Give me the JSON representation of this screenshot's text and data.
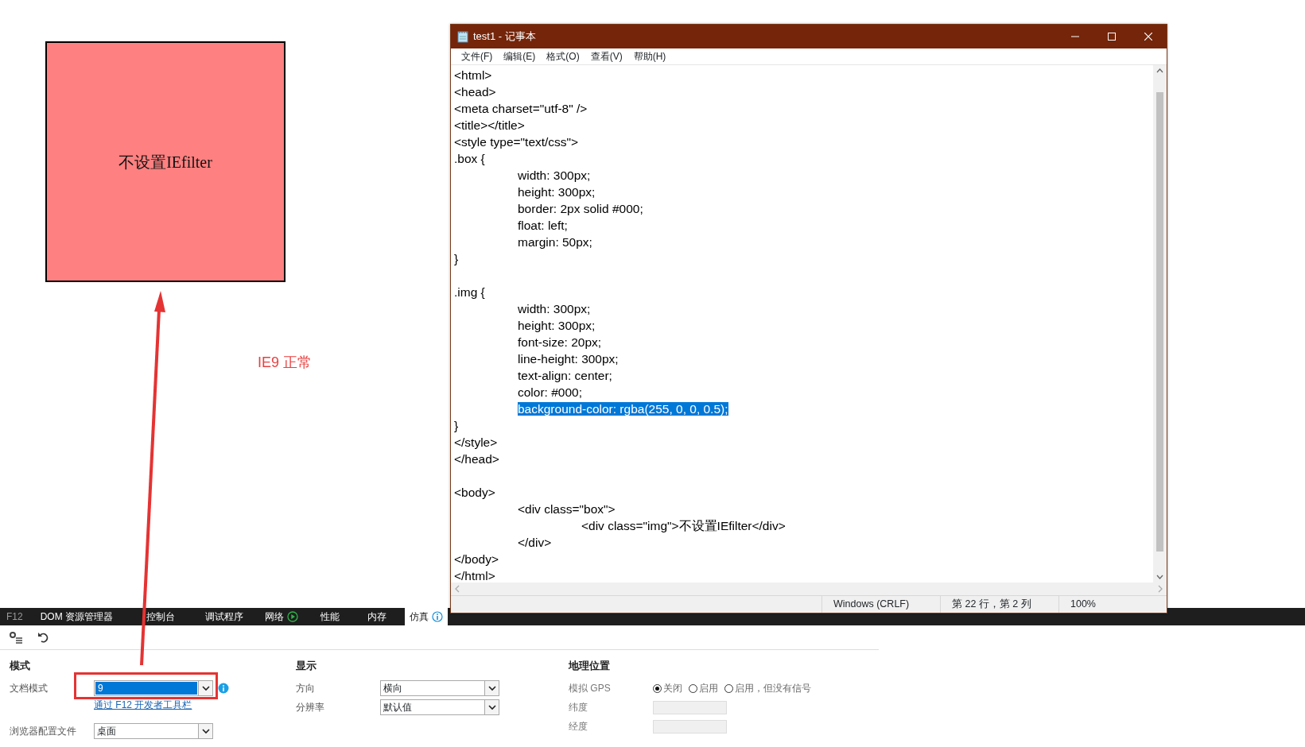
{
  "background_page": {
    "box_text": "不设置IEfilter",
    "annotation": "IE9 正常"
  },
  "notepad": {
    "title": "test1 - 记事本",
    "menu": [
      "文件(F)",
      "编辑(E)",
      "格式(O)",
      "查看(V)",
      "帮助(H)"
    ],
    "lines": [
      {
        "kind": "code",
        "text": "<html>",
        "selected": false
      },
      {
        "kind": "code",
        "text": "<head>",
        "selected": false
      },
      {
        "kind": "code",
        "text": "<meta charset=\"utf-8\" />",
        "selected": false
      },
      {
        "kind": "code",
        "text": "<title></title>",
        "selected": false
      },
      {
        "kind": "code",
        "text": "<style type=\"text/css\">",
        "selected": false
      },
      {
        "kind": "code",
        "text": ".box {",
        "selected": false
      },
      {
        "kind": "code",
        "text": "\twidth: 300px;",
        "selected": false
      },
      {
        "kind": "code",
        "text": "\theight: 300px;",
        "selected": false
      },
      {
        "kind": "code",
        "text": "\tborder: 2px solid #000;",
        "selected": false
      },
      {
        "kind": "code",
        "text": "\tfloat: left;",
        "selected": false
      },
      {
        "kind": "code",
        "text": "\tmargin: 50px;",
        "selected": false
      },
      {
        "kind": "code",
        "text": "}",
        "selected": false
      },
      {
        "kind": "blank",
        "selected": false
      },
      {
        "kind": "code",
        "text": ".img {",
        "selected": false
      },
      {
        "kind": "code",
        "text": "\twidth: 300px;",
        "selected": false
      },
      {
        "kind": "code",
        "text": "\theight: 300px;",
        "selected": false
      },
      {
        "kind": "code",
        "text": "\tfont-size: 20px;",
        "selected": false
      },
      {
        "kind": "code",
        "text": "\tline-height: 300px;",
        "selected": false
      },
      {
        "kind": "code",
        "text": "\ttext-align: center;",
        "selected": false
      },
      {
        "kind": "code",
        "text": "\tcolor: #000;",
        "selected": false
      },
      {
        "kind": "code",
        "text": "\tbackground-color: rgba(255, 0, 0, 0.5);",
        "selected": true
      },
      {
        "kind": "code",
        "text": "}",
        "selected": false
      },
      {
        "kind": "code",
        "text": "</style>",
        "selected": false
      },
      {
        "kind": "code",
        "text": "</head>",
        "selected": false
      },
      {
        "kind": "blank",
        "selected": false
      },
      {
        "kind": "code",
        "text": "<body>",
        "selected": false
      },
      {
        "kind": "code",
        "text": "\t<div class=\"box\">",
        "selected": false
      },
      {
        "kind": "code",
        "text": "\t\t<div class=\"img\">不设置IEfilter</div>",
        "selected": false
      },
      {
        "kind": "code",
        "text": "\t</div>",
        "selected": false
      },
      {
        "kind": "code",
        "text": "</body>",
        "selected": false
      },
      {
        "kind": "code",
        "text": "</html>",
        "selected": false
      }
    ],
    "status_bar": [
      "Windows (CRLF)",
      "第 22 行，第 2 列",
      "100%"
    ]
  },
  "devtools": {
    "label": "F12",
    "tabs": [
      {
        "label": "DOM 资源管理器",
        "kind": "plain",
        "selected": false
      },
      {
        "label": "控制台",
        "kind": "plain",
        "selected": false
      },
      {
        "label": "调试程序",
        "kind": "plain",
        "selected": false
      },
      {
        "label": "网络",
        "kind": "play",
        "selected": false
      },
      {
        "label": "性能",
        "kind": "plain",
        "selected": false
      },
      {
        "label": "内存",
        "kind": "plain",
        "selected": false
      },
      {
        "label": "仿真",
        "kind": "info",
        "selected": true
      }
    ],
    "sections": [
      {
        "heading": "模式",
        "fields": [
          {
            "kind": "select",
            "label": "文档模式",
            "value": "9",
            "highlighted": true,
            "info": true
          },
          {
            "kind": "link",
            "text": "通过 F12 开发者工具栏"
          },
          {
            "kind": "select",
            "label": "浏览器配置文件",
            "value": "桌面",
            "highlighted": false,
            "info": false
          }
        ]
      },
      {
        "heading": "显示",
        "fields": [
          {
            "kind": "select",
            "label": "方向",
            "value": "横向",
            "highlighted": false,
            "info": false
          },
          {
            "kind": "select",
            "label": "分辨率",
            "value": "默认值",
            "highlighted": false,
            "info": false
          }
        ]
      },
      {
        "heading": "地理位置",
        "fields": [
          {
            "kind": "radios",
            "label": "模拟 GPS",
            "options": [
              {
                "label": "关闭",
                "selected": true
              },
              {
                "label": "启用",
                "selected": false
              },
              {
                "label": "启用，但没有信号",
                "selected": false
              }
            ]
          },
          {
            "kind": "text",
            "label": "纬度",
            "disabled": true
          },
          {
            "kind": "text",
            "label": "经度",
            "disabled": true
          }
        ]
      }
    ]
  }
}
